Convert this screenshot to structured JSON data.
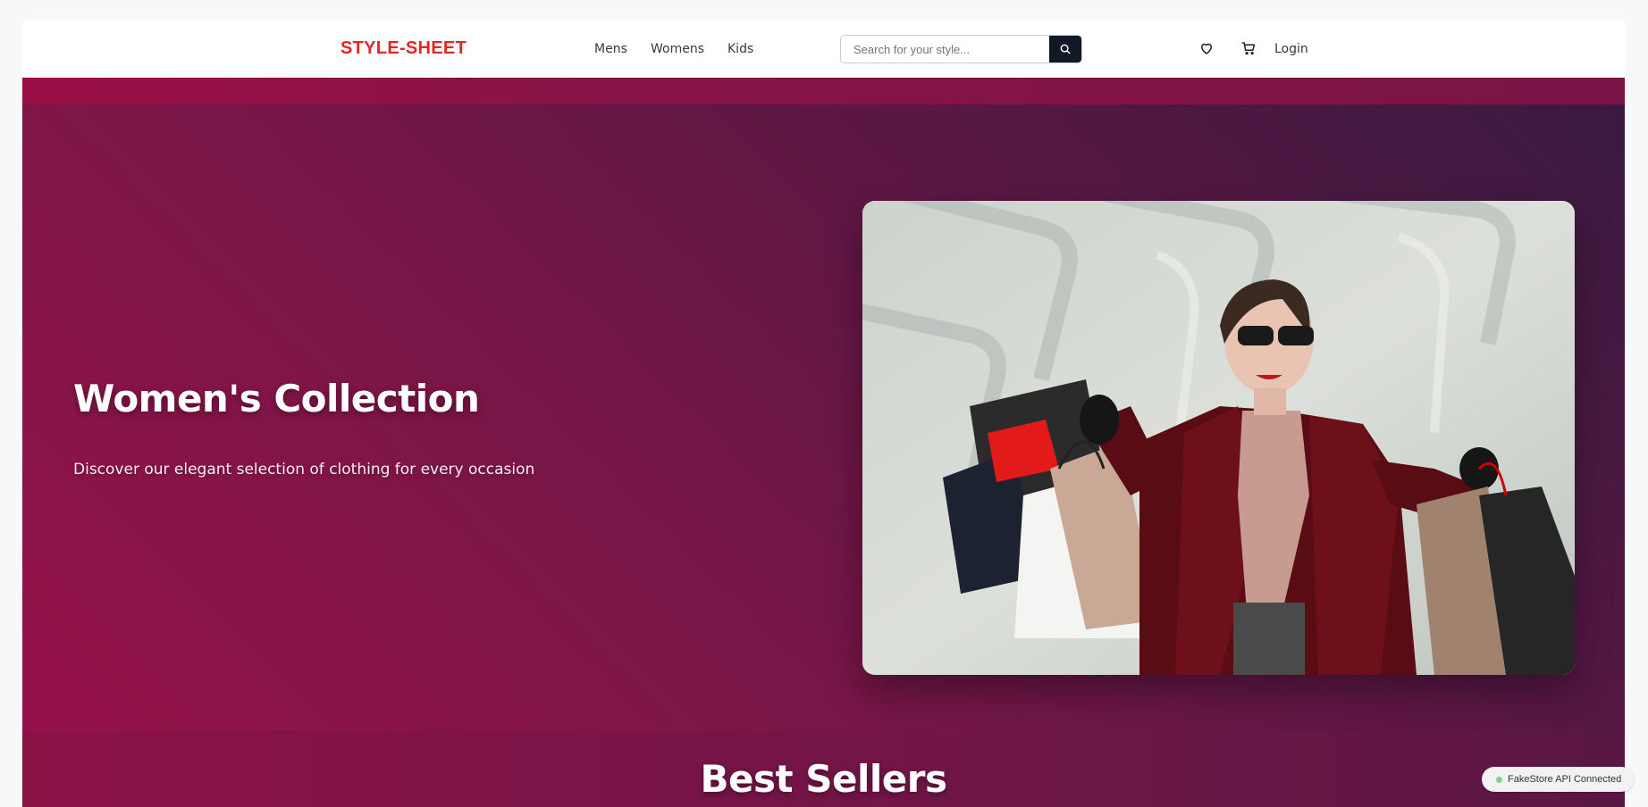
{
  "navbar": {
    "logo": "STYLE-SHEET",
    "links": [
      "Mens",
      "Womens",
      "Kids"
    ],
    "search": {
      "placeholder": "Search for your style...",
      "value": ""
    },
    "search_button_icon": "search-icon",
    "wishlist_icon": "heart-icon",
    "cart_icon": "cart-icon",
    "login_label": "Login"
  },
  "hero": {
    "title": "Women's Collection",
    "subtitle": "Discover our elegant selection of clothing for every occasion"
  },
  "best_sellers": {
    "title": "Best Sellers"
  },
  "status": {
    "label": "FakeStore API Connected",
    "color": "#7fd18d"
  },
  "colors": {
    "brand": "#e3262a",
    "hero_start": "#951249",
    "hero_end": "#3a1a40",
    "search_button": "#121826"
  }
}
